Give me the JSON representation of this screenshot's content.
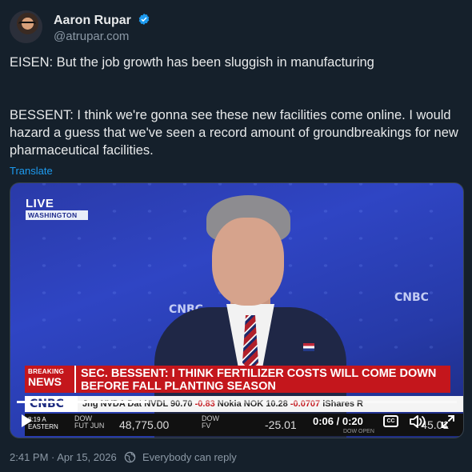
{
  "author": {
    "name": "Aaron Rupar",
    "handle": "@atrupar.com",
    "verified": true
  },
  "tweet": {
    "paragraph1": "EISEN: But the job growth has been sluggish in manufacturing",
    "paragraph2": "BESSENT: I think we're gonna see these new facilities come online. I would hazard a guess that we've seen a record amount of groundbreakings for new pharmaceutical facilities.",
    "translate_label": "Translate"
  },
  "video": {
    "live_label": "LIVE",
    "location_label": "WASHINGTON",
    "wall_logo": "CNBC",
    "breaking_top": "BREAKING",
    "breaking_bottom": "NEWS",
    "headline": "SEC. BESSENT: I THINK FERTILIZER COSTS WILL COME DOWN BEFORE FALL PLANTING SEASON",
    "ticker_logo": "CNBC",
    "ticker": {
      "t1": "Jng NVDA Dat ",
      "t2": "NVDL 90.70 ",
      "t3": "-0.83",
      "t4": "  Nokia ",
      "t5": "NOK 10.28 ",
      "t6": "-0.0707",
      "t7": "   iShares R"
    },
    "market": {
      "time": "8:19 A",
      "zone": "EASTERN",
      "idx1_line1": "DOW",
      "idx1_line2": "FUT  JUN",
      "val1": "48,775.00",
      "idx2_line1": "DOW",
      "idx2_line2": "FV",
      "val2": "-25.01",
      "right_text": "DOW OPEN",
      "right_val": "+45.01"
    },
    "player": {
      "elapsed": "0:06",
      "total": "0:20",
      "timer_text": "0:06 / 0:20",
      "progress_fraction": 0.3,
      "cc_label": "CC"
    }
  },
  "footer": {
    "timestamp": "2:41 PM · Apr 15, 2026",
    "reply_setting": "Everybody can reply"
  },
  "colors": {
    "background": "#15202b",
    "link": "#1d9bf0",
    "breaking_red": "#c4161c"
  }
}
